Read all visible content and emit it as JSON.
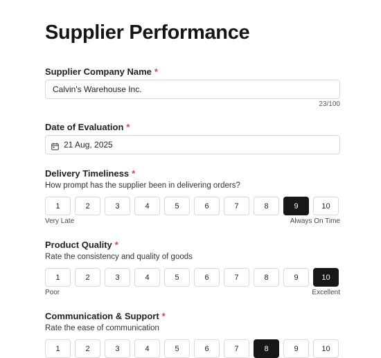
{
  "form": {
    "title": "Supplier Performance",
    "required_marker": "*",
    "company": {
      "label": "Supplier Company Name",
      "value": "Calvin's Warehouse Inc.",
      "counter": "23/100"
    },
    "date": {
      "label": "Date of Evaluation",
      "value": "21 Aug, 2025",
      "icon": "calendar-icon"
    },
    "delivery": {
      "label": "Delivery Timeliness",
      "help": "How prompt has the supplier been in delivering orders?",
      "options": [
        "1",
        "2",
        "3",
        "4",
        "5",
        "6",
        "7",
        "8",
        "9",
        "10"
      ],
      "selected": "9",
      "low": "Very Late",
      "high": "Always On Time"
    },
    "quality": {
      "label": "Product Quality",
      "help": "Rate the consistency and quality of goods",
      "options": [
        "1",
        "2",
        "3",
        "4",
        "5",
        "6",
        "7",
        "8",
        "9",
        "10"
      ],
      "selected": "10",
      "low": "Poor",
      "high": "Excellent"
    },
    "communication": {
      "label": "Communication & Support",
      "help": "Rate the ease of communication",
      "options": [
        "1",
        "2",
        "3",
        "4",
        "5",
        "6",
        "7",
        "8",
        "9",
        "10"
      ],
      "selected": "8"
    }
  }
}
